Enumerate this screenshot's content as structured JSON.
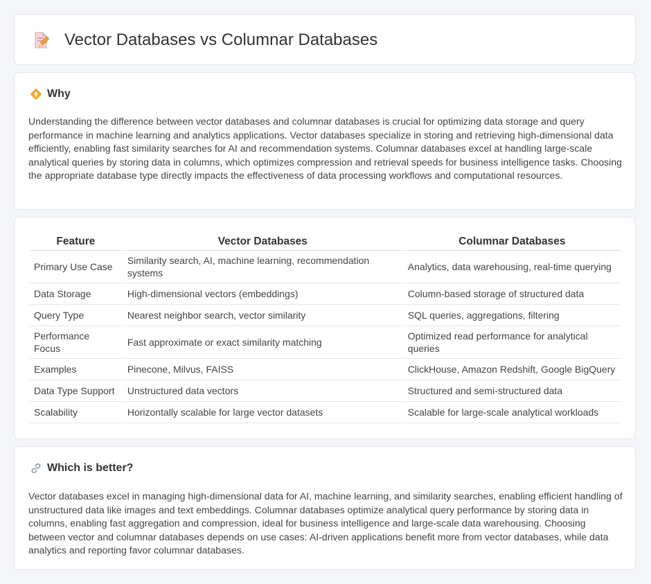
{
  "header": {
    "title": "Vector Databases vs Columnar Databases",
    "icon": "document-pencil-icon"
  },
  "why": {
    "icon": "diamond-lightbulb-icon",
    "title": "Why",
    "body": "Understanding the difference between vector databases and columnar databases is crucial for optimizing data storage and query performance in machine learning and analytics applications. Vector databases specialize in storing and retrieving high-dimensional data efficiently, enabling fast similarity searches for AI and recommendation systems. Columnar databases excel at handling large-scale analytical queries by storing data in columns, which optimizes compression and retrieval speeds for business intelligence tasks. Choosing the appropriate database type directly impacts the effectiveness of data processing workflows and computational resources."
  },
  "table": {
    "headers": [
      "Feature",
      "Vector Databases",
      "Columnar Databases"
    ],
    "rows": [
      [
        "Primary Use Case",
        "Similarity search, AI, machine learning, recommendation systems",
        "Analytics, data warehousing, real-time querying"
      ],
      [
        "Data Storage",
        "High-dimensional vectors (embeddings)",
        "Column-based storage of structured data"
      ],
      [
        "Query Type",
        "Nearest neighbor search, vector similarity",
        "SQL queries, aggregations, filtering"
      ],
      [
        "Performance Focus",
        "Fast approximate or exact similarity matching",
        "Optimized read performance for analytical queries"
      ],
      [
        "Examples",
        "Pinecone, Milvus, FAISS",
        "ClickHouse, Amazon Redshift, Google BigQuery"
      ],
      [
        "Data Type Support",
        "Unstructured data vectors",
        "Structured and semi-structured data"
      ],
      [
        "Scalability",
        "Horizontally scalable for large vector datasets",
        "Scalable for large-scale analytical workloads"
      ]
    ]
  },
  "better": {
    "icon": "link-icon",
    "title": "Which is better?",
    "body": "Vector databases excel in managing high-dimensional data for AI, machine learning, and similarity searches, enabling efficient handling of unstructured data like images and text embeddings. Columnar databases optimize analytical query performance by storing data in columns, enabling fast aggregation and compression, ideal for business intelligence and large-scale data warehousing. Choosing between vector and columnar databases depends on use cases: AI-driven applications benefit more from vector databases, while data analytics and reporting favor columnar databases."
  }
}
